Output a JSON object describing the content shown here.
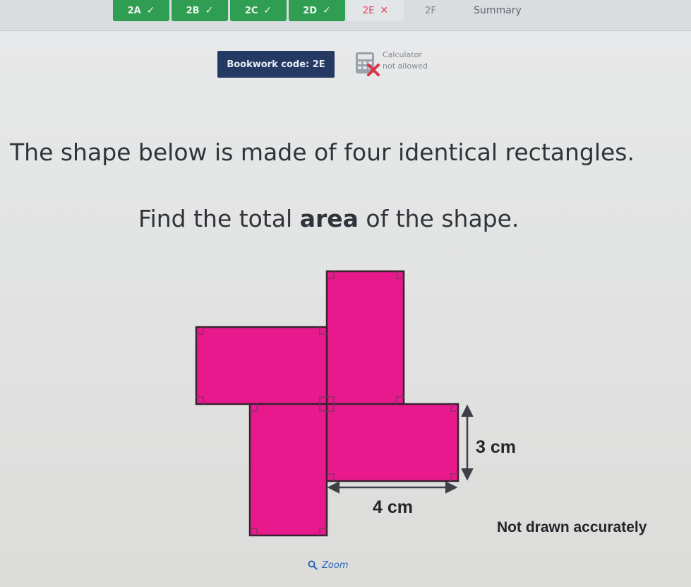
{
  "tabs": [
    {
      "label": "2A",
      "status": "done",
      "mark": "✓"
    },
    {
      "label": "2B",
      "status": "done",
      "mark": "✓"
    },
    {
      "label": "2C",
      "status": "done",
      "mark": "✓"
    },
    {
      "label": "2D",
      "status": "done",
      "mark": "✓"
    },
    {
      "label": "2E",
      "status": "wrong",
      "mark": "✕"
    },
    {
      "label": "2F",
      "status": "pending",
      "mark": ""
    },
    {
      "label": "Summary",
      "status": "pending",
      "mark": ""
    }
  ],
  "bookwork": {
    "label": "Bookwork code: 2E"
  },
  "calculator": {
    "line1": "Calculator",
    "line2": "not allowed"
  },
  "question": {
    "line1": "The shape below is made of four identical rectangles.",
    "line2_before": "Find the total ",
    "line2_bold": "area",
    "line2_after": " of the shape."
  },
  "diagram": {
    "height_label": "3 cm",
    "width_label": "4 cm",
    "note": "Not drawn accurately",
    "fill_color": "#e8198d",
    "stroke_color": "#3a2230"
  },
  "zoom": {
    "label": "Zoom"
  },
  "colors": {
    "done": "#2f9e53",
    "wrong": "#e0475a",
    "bookwork": "#243a63"
  }
}
